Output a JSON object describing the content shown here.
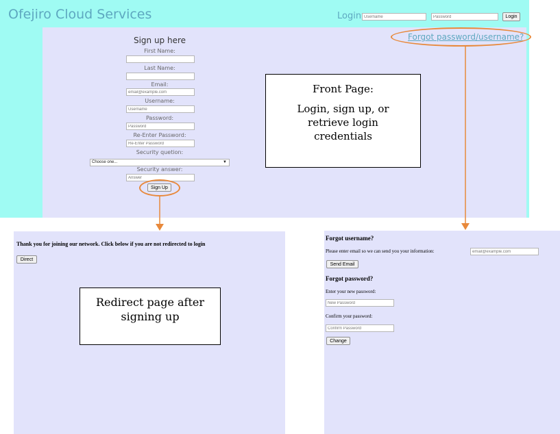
{
  "front_page": {
    "site_title": "Ofejiro Cloud Services",
    "login_label": "Login:",
    "username_placeholder": "Username",
    "password_placeholder": "Password",
    "login_button": "Login",
    "forgot_link": "Forgot password/username?",
    "signup": {
      "title": "Sign up here",
      "first_name_label": "First Name:",
      "last_name_label": "Last Name:",
      "email_label": "Email:",
      "email_placeholder": "email@example.com",
      "username_label": "Username:",
      "username_placeholder": "Username",
      "password_label": "Password:",
      "password_placeholder": "Password",
      "reenter_label": "Re-Enter Password:",
      "reenter_placeholder": "Re-Enter Password",
      "security_question_label": "Security quetion:",
      "security_question_value": "Choose one...",
      "security_answer_label": "Security answer:",
      "answer_placeholder": "Answer",
      "signup_button": "Sign Up"
    },
    "callout": {
      "line1": "Front Page:",
      "line2": "Login, sign up, or retrieve login credentials"
    }
  },
  "redirect_page": {
    "message": "Thank you for joining our network. Click below if you are not redirected to login",
    "direct_button": "Direct",
    "callout": "Redirect page after signing up"
  },
  "forgot_page": {
    "forgot_username_heading": "Forgot username?",
    "email_prompt": "Please enter email so we can send you your information:",
    "email_placeholder": "email@example.com",
    "send_email_button": "Send Email",
    "forgot_password_heading": "Forgot password?",
    "new_password_label": "Enter your new password:",
    "new_password_placeholder": "New Password",
    "confirm_label": "Confirm your password:",
    "confirm_placeholder": "Confirm Password",
    "change_button": "Change"
  },
  "colors": {
    "header_bg": "#9ffbf3",
    "panel_bg": "#e2e3fb",
    "link_text": "#5ea8c0",
    "annotation": "#e8893b"
  }
}
